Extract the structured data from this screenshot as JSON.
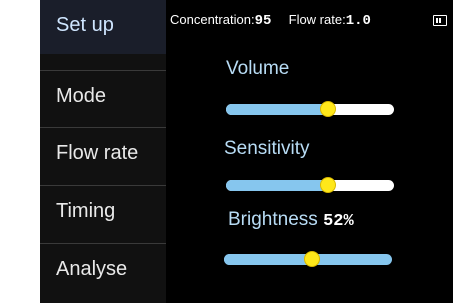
{
  "menu": [
    {
      "label": "Set up",
      "active": true
    },
    {
      "label": "Mode",
      "active": false
    },
    {
      "label": "Flow rate",
      "active": false
    },
    {
      "label": "Timing",
      "active": false
    },
    {
      "label": "Analyse",
      "active": false
    }
  ],
  "status": {
    "concentration_label": "Concentration:",
    "concentration_value": "95",
    "flow_rate_label": "Flow rate:",
    "flow_rate_value": "1.0"
  },
  "settings": {
    "volume": {
      "label": "Volume",
      "level": 0.6
    },
    "sensitivity": {
      "label": "Sensitivity",
      "level": 0.6
    },
    "brightness": {
      "label": "Brightness",
      "value": "52%",
      "level": 0.52
    }
  },
  "colors": {
    "accent": "#86c6ee",
    "knob": "#ffe81a",
    "background": "#000000"
  }
}
